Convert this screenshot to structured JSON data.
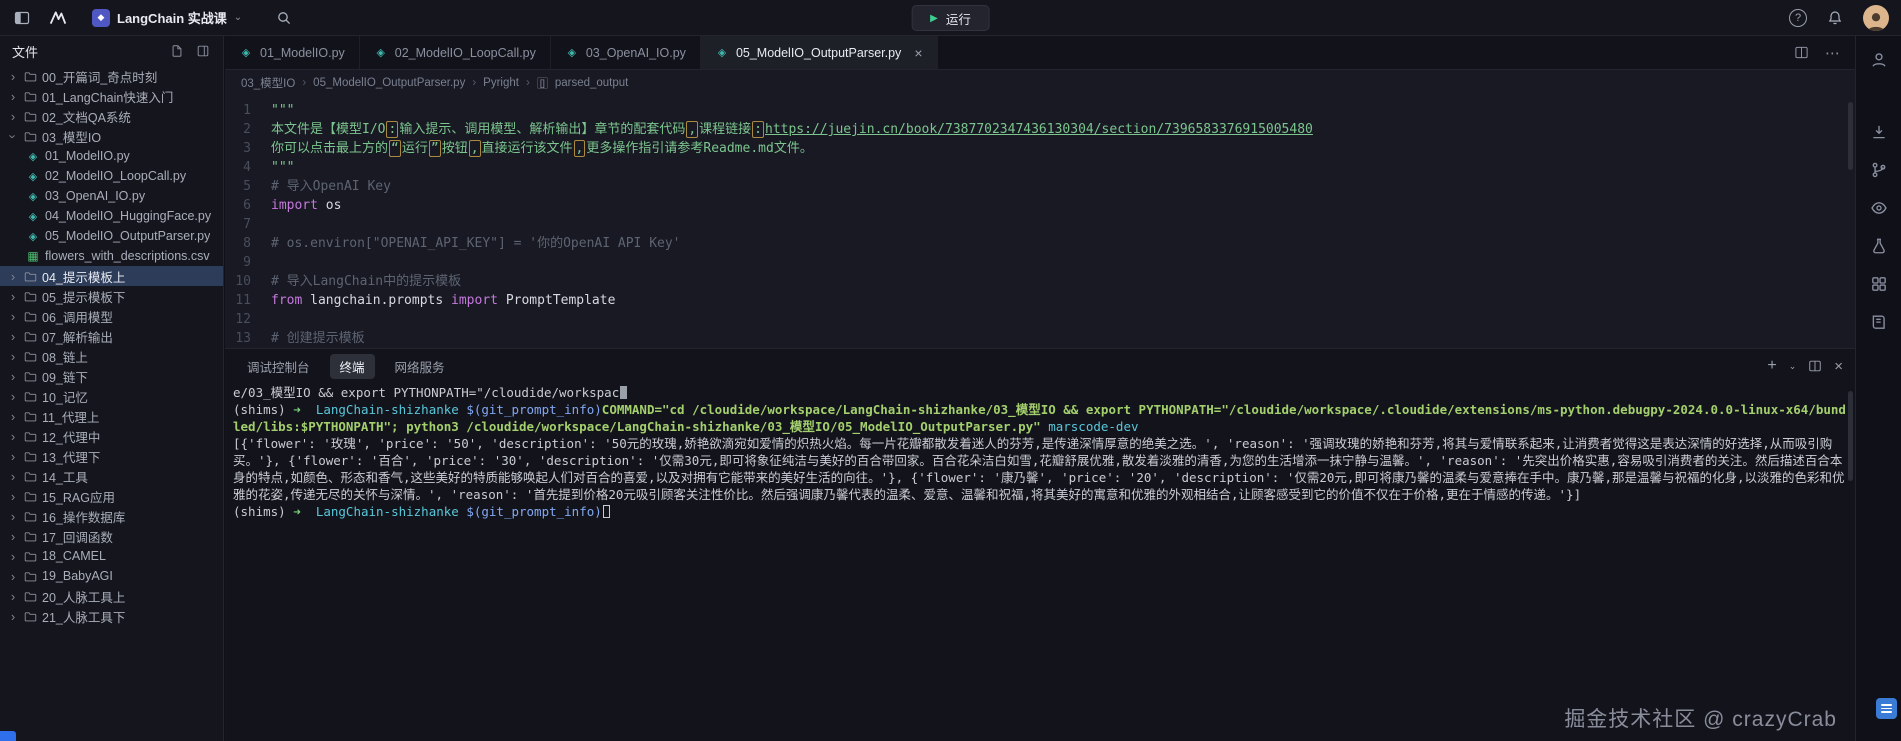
{
  "topbar": {
    "workspace_label": "LangChain 实战课",
    "run_button": "运行"
  },
  "icons": {
    "play": "▶",
    "chevron_down": "⌄",
    "chevron_right": "›",
    "close": "×",
    "plus": "+",
    "more": "⋯",
    "help": "?"
  },
  "sidebar": {
    "title": "文件",
    "items": [
      {
        "label": "00_开篇词_奇点时刻",
        "type": "folder",
        "depth": 0
      },
      {
        "label": "01_LangChain快速入门",
        "type": "folder",
        "depth": 0
      },
      {
        "label": "02_文档QA系统",
        "type": "folder",
        "depth": 0
      },
      {
        "label": "03_模型IO",
        "type": "folder",
        "depth": 0,
        "expanded": true
      },
      {
        "label": "01_ModelIO.py",
        "type": "python",
        "depth": 1
      },
      {
        "label": "02_ModelIO_LoopCall.py",
        "type": "python",
        "depth": 1
      },
      {
        "label": "03_OpenAI_IO.py",
        "type": "python",
        "depth": 1
      },
      {
        "label": "04_ModelIO_HuggingFace.py",
        "type": "python",
        "depth": 1
      },
      {
        "label": "05_ModelIO_OutputParser.py",
        "type": "python",
        "depth": 1
      },
      {
        "label": "flowers_with_descriptions.csv",
        "type": "csv",
        "depth": 1
      },
      {
        "label": "04_提示模板上",
        "type": "folder",
        "depth": 0,
        "selected": true
      },
      {
        "label": "05_提示模板下",
        "type": "folder",
        "depth": 0
      },
      {
        "label": "06_调用模型",
        "type": "folder",
        "depth": 0
      },
      {
        "label": "07_解析输出",
        "type": "folder",
        "depth": 0
      },
      {
        "label": "08_链上",
        "type": "folder",
        "depth": 0
      },
      {
        "label": "09_链下",
        "type": "folder",
        "depth": 0
      },
      {
        "label": "10_记忆",
        "type": "folder",
        "depth": 0
      },
      {
        "label": "11_代理上",
        "type": "folder",
        "depth": 0
      },
      {
        "label": "12_代理中",
        "type": "folder",
        "depth": 0
      },
      {
        "label": "13_代理下",
        "type": "folder",
        "depth": 0
      },
      {
        "label": "14_工具",
        "type": "folder",
        "depth": 0
      },
      {
        "label": "15_RAG应用",
        "type": "folder",
        "depth": 0
      },
      {
        "label": "16_操作数据库",
        "type": "folder",
        "depth": 0
      },
      {
        "label": "17_回调函数",
        "type": "folder",
        "depth": 0
      },
      {
        "label": "18_CAMEL",
        "type": "folder",
        "depth": 0
      },
      {
        "label": "19_BabyAGI",
        "type": "folder",
        "depth": 0
      },
      {
        "label": "20_人脉工具上",
        "type": "folder",
        "depth": 0
      },
      {
        "label": "21_人脉工具下",
        "type": "folder",
        "depth": 0
      }
    ]
  },
  "tabs": [
    {
      "label": "01_ModelIO.py"
    },
    {
      "label": "02_ModelIO_LoopCall.py"
    },
    {
      "label": "03_OpenAI_IO.py"
    },
    {
      "label": "05_ModelIO_OutputParser.py",
      "active": true
    }
  ],
  "breadcrumb": {
    "items": [
      "03_模型IO",
      "05_ModelIO_OutputParser.py",
      "Pyright",
      "parsed_output"
    ]
  },
  "editor": {
    "lines": [
      {
        "n": 1,
        "seg": [
          {
            "t": "\"\"\"",
            "c": "str"
          }
        ]
      },
      {
        "n": 2,
        "seg": [
          {
            "t": "本文件是【模型I/O",
            "c": "str"
          },
          {
            "t": ":",
            "c": "strbox"
          },
          {
            "t": "输入提示、调用模型、解析输出】章节的配套代码",
            "c": "str"
          },
          {
            "t": ",",
            "c": "strbox"
          },
          {
            "t": "课程链接",
            "c": "str"
          },
          {
            "t": ":",
            "c": "strbox"
          },
          {
            "t": "https://juejin.cn/book/7387702347436130304/section/7396583376915005480",
            "c": "url"
          }
        ]
      },
      {
        "n": 3,
        "seg": [
          {
            "t": "你可以点击最上方的",
            "c": "str"
          },
          {
            "t": "“",
            "c": "strbox"
          },
          {
            "t": "运行",
            "c": "str"
          },
          {
            "t": "”",
            "c": "strbox"
          },
          {
            "t": "按钮",
            "c": "str"
          },
          {
            "t": ",",
            "c": "strbox"
          },
          {
            "t": "直接运行该文件",
            "c": "str"
          },
          {
            "t": ",",
            "c": "strbox"
          },
          {
            "t": "更多操作指引请参考Readme.md文件。",
            "c": "str"
          }
        ]
      },
      {
        "n": 4,
        "seg": [
          {
            "t": "\"\"\"",
            "c": "str"
          }
        ]
      },
      {
        "n": 5,
        "seg": [
          {
            "t": "# 导入OpenAI Key",
            "c": "comment"
          }
        ]
      },
      {
        "n": 6,
        "seg": [
          {
            "t": "import",
            "c": "kw"
          },
          {
            "t": " os",
            "c": "plain"
          }
        ]
      },
      {
        "n": 7,
        "seg": []
      },
      {
        "n": 8,
        "seg": [
          {
            "t": "# os.environ[\"OPENAI_API_KEY\"] = '你的OpenAI API Key'",
            "c": "comment"
          }
        ]
      },
      {
        "n": 9,
        "seg": []
      },
      {
        "n": 10,
        "seg": [
          {
            "t": "# 导入LangChain中的提示模板",
            "c": "comment"
          }
        ]
      },
      {
        "n": 11,
        "seg": [
          {
            "t": "from",
            "c": "kw"
          },
          {
            "t": " langchain.prompts ",
            "c": "plain"
          },
          {
            "t": "import",
            "c": "kw"
          },
          {
            "t": " PromptTemplate",
            "c": "plain"
          }
        ]
      },
      {
        "n": 12,
        "seg": []
      },
      {
        "n": 13,
        "seg": [
          {
            "t": "# 创建提示模板",
            "c": "comment"
          }
        ]
      }
    ]
  },
  "panel": {
    "tabs": [
      {
        "label": "调试控制台"
      },
      {
        "label": "终端",
        "active": true
      },
      {
        "label": "网络服务"
      }
    ]
  },
  "terminal": {
    "lines": [
      [
        {
          "t": "e/03_模型IO && export PYTHONPATH=\"/cloudide/workspac",
          "c": "plain"
        },
        {
          "cursor": "dim"
        }
      ],
      [
        {
          "t": "(shims) ",
          "c": "plain"
        },
        {
          "t": "➜",
          "c": "green"
        },
        {
          "t": "  ",
          "c": "plain"
        },
        {
          "t": "LangChain-shizhanke ",
          "c": "cyan"
        },
        {
          "t": "$(git_prompt_info)",
          "c": "blue"
        },
        {
          "t": "COMMAND=\"cd /cloudide/workspace/LangChain-shizhanke/03_模型IO && export PYTHONPATH=\"/cloudide/workspace/.cloudide/extensions/ms-python.debugpy-2024.0.0-linux-x64/bundled/libs:$PYTHONPATH\"; python3 /cloudide/workspace/LangChain-shizhanke/03_模型IO/05_ModelIO_OutputParser.py\" ",
          "c": "cmd"
        },
        {
          "t": "marscode-dev",
          "c": "cyan"
        }
      ],
      [
        {
          "t": "[{'flower': '玫瑰', 'price': '50', 'description': '50元的玫瑰,娇艳欲滴宛如爱情的炽热火焰。每一片花瓣都散发着迷人的芬芳,是传递深情厚意的绝美之选。', 'reason': '强调玫瑰的娇艳和芬芳,将其与爱情联系起来,让消费者觉得这是表达深情的好选择,从而吸引购买。'}, {'flower': '百合', 'price': '30', 'description': '仅需30元,即可将象征纯洁与美好的百合带回家。百合花朵洁白如雪,花瓣舒展优雅,散发着淡雅的清香,为您的生活增添一抹宁静与温馨。', 'reason': '先突出价格实惠,容易吸引消费者的关注。然后描述百合本身的特点,如颜色、形态和香气,这些美好的特质能够唤起人们对百合的喜爱,以及对拥有它能带来的美好生活的向往。'}, {'flower': '康乃馨', 'price': '20', 'description': '仅需20元,即可将康乃馨的温柔与爱意捧在手中。康乃馨,那是温馨与祝福的化身,以淡雅的色彩和优雅的花姿,传递无尽的关怀与深情。', 'reason': '首先提到价格20元吸引顾客关注性价比。然后强调康乃馨代表的温柔、爱意、温馨和祝福,将其美好的寓意和优雅的外观相结合,让顾客感受到它的价值不仅在于价格,更在于情感的传递。'}]",
          "c": "plain"
        }
      ],
      [
        {
          "t": "(shims) ",
          "c": "plain"
        },
        {
          "t": "➜",
          "c": "green"
        },
        {
          "t": "  ",
          "c": "plain"
        },
        {
          "t": "LangChain-shizhanke ",
          "c": "cyan"
        },
        {
          "t": "$(git_prompt_info)",
          "c": "blue"
        },
        {
          "cursor": "hollow"
        }
      ]
    ]
  },
  "watermark": "掘金技术社区 @ crazyCrab",
  "colors": {
    "accent_green": "#3ecf8e",
    "string_green": "#7cc58e",
    "keyword_purple": "#c678dd",
    "comment_gray": "#5d6471",
    "selected_row_blue": "#2d3c59"
  }
}
